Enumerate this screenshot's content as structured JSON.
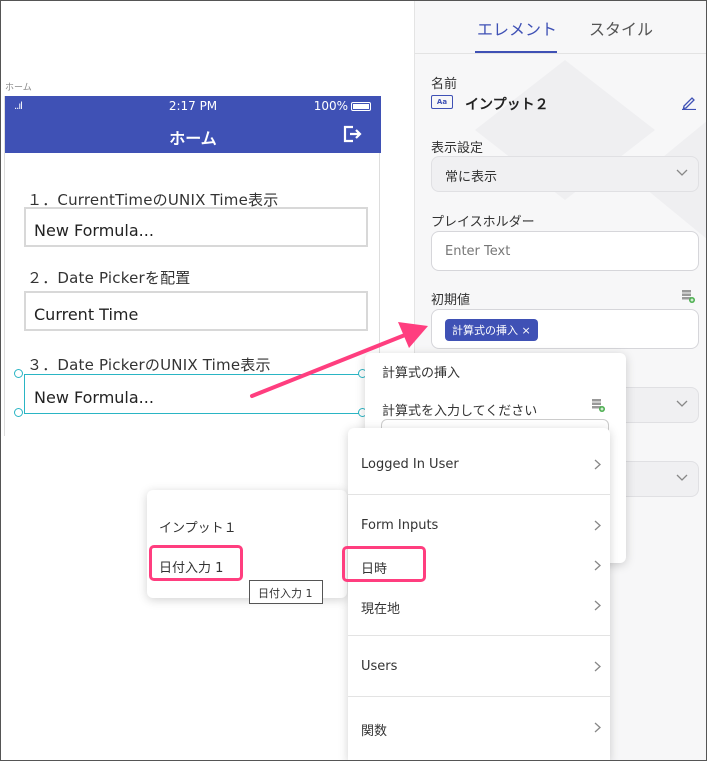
{
  "canvas": {
    "screen_label": "ホーム",
    "status": {
      "signal": "..ıl",
      "time": "2:17 PM",
      "battery": "100%"
    },
    "header_title": "ホーム",
    "fields": [
      {
        "label": "１．CurrentTimeのUNIX Time表示",
        "value": "New Formula..."
      },
      {
        "label": "２．Date Pickerを配置",
        "value": "Current Time"
      },
      {
        "label": "３．Date PickerのUNIX Time表示",
        "value": "New Formula..."
      }
    ]
  },
  "right_panel": {
    "tabs": [
      "エレメント",
      "スタイル"
    ],
    "active_tab": "エレメント",
    "name_label": "名前",
    "name_icon_text": "Aa",
    "name_value": "インプット２",
    "visibility_label": "表示設定",
    "visibility_value": "常に表示",
    "placeholder_label": "プレイスホルダー",
    "placeholder_value": "Enter Text",
    "initial_value_label": "初期値",
    "initial_value_tag": "計算式の挿入 ×"
  },
  "formula_popup": {
    "title": "計算式の挿入",
    "prompt": "計算式を入力してください"
  },
  "variables_menu": {
    "items": [
      "Logged In User",
      "Form Inputs",
      "日時",
      "現在地",
      "Users",
      "関数"
    ]
  },
  "inputs_menu": {
    "items": [
      "インプット１",
      "日付入力 1"
    ]
  },
  "tooltip": "日付入力 1",
  "colors": {
    "primary": "#3f51b5",
    "highlight": "#ff3e7f",
    "selection": "#2ab5c4"
  }
}
